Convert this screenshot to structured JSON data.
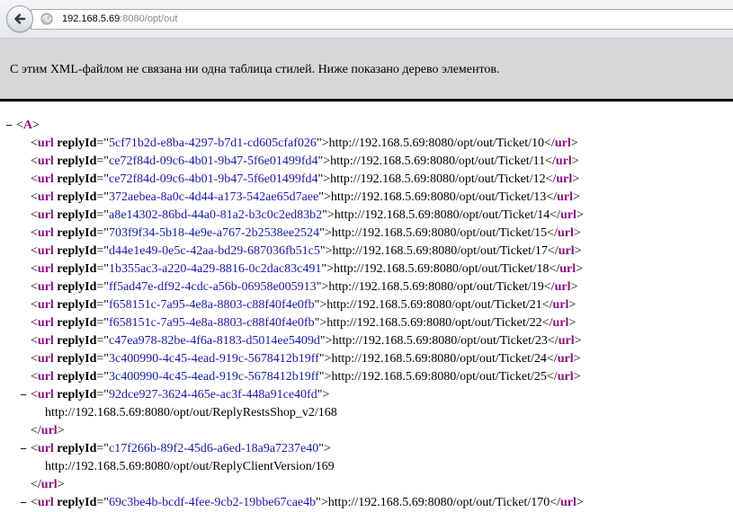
{
  "browser": {
    "url_host": "192.168.5.69",
    "url_rest": ":8080/opt/out"
  },
  "info_message": "С этим XML-файлом не связана ни одна таблица стилей. Ниже показано дерево элементов.",
  "xml": {
    "root_tag": "A",
    "child_tag": "url",
    "attr_name": "replyId",
    "toggle_symbol": "−",
    "single_line_items": [
      {
        "reply_id": "5cf71b2d-e8ba-4297-b7d1-cd605cfaf026",
        "text": "http://192.168.5.69:8080/opt/out/Ticket/10"
      },
      {
        "reply_id": "ce72f84d-09c6-4b01-9b47-5f6e01499fd4",
        "text": "http://192.168.5.69:8080/opt/out/Ticket/11"
      },
      {
        "reply_id": "ce72f84d-09c6-4b01-9b47-5f6e01499fd4",
        "text": "http://192.168.5.69:8080/opt/out/Ticket/12"
      },
      {
        "reply_id": "372aebea-8a0c-4d44-a173-542ae65d7aee",
        "text": "http://192.168.5.69:8080/opt/out/Ticket/13"
      },
      {
        "reply_id": "a8e14302-86bd-44a0-81a2-b3c0c2ed83b2",
        "text": "http://192.168.5.69:8080/opt/out/Ticket/14"
      },
      {
        "reply_id": "703f9f34-5b18-4e9e-a767-2b2538ee2524",
        "text": "http://192.168.5.69:8080/opt/out/Ticket/15"
      },
      {
        "reply_id": "d44e1e49-0e5c-42aa-bd29-687036fb51c5",
        "text": "http://192.168.5.69:8080/opt/out/Ticket/17"
      },
      {
        "reply_id": "1b355ac3-a220-4a29-8816-0c2dac83c491",
        "text": "http://192.168.5.69:8080/opt/out/Ticket/18"
      },
      {
        "reply_id": "ff5ad47e-df92-4cdc-a56b-06958e005913",
        "text": "http://192.168.5.69:8080/opt/out/Ticket/19"
      },
      {
        "reply_id": "f658151c-7a95-4e8a-8803-c88f40f4e0fb",
        "text": "http://192.168.5.69:8080/opt/out/Ticket/21"
      },
      {
        "reply_id": "f658151c-7a95-4e8a-8803-c88f40f4e0fb",
        "text": "http://192.168.5.69:8080/opt/out/Ticket/22"
      },
      {
        "reply_id": "c47ea978-82be-4f6a-8183-d5014ee5409d",
        "text": "http://192.168.5.69:8080/opt/out/Ticket/23"
      },
      {
        "reply_id": "3c400990-4c45-4ead-919c-5678412b19ff",
        "text": "http://192.168.5.69:8080/opt/out/Ticket/24"
      },
      {
        "reply_id": "3c400990-4c45-4ead-919c-5678412b19ff",
        "text": "http://192.168.5.69:8080/opt/out/Ticket/25"
      }
    ],
    "expanded_items": [
      {
        "reply_id": "92dce927-3624-465e-ac3f-448a91ce40fd",
        "text": "http://192.168.5.69:8080/opt/out/ReplyRestsShop_v2/168"
      },
      {
        "reply_id": "c17f266b-89f2-45d6-a6ed-18a9a7237e40",
        "text": "http://192.168.5.69:8080/opt/out/ReplyClientVersion/169"
      }
    ],
    "partial_item": {
      "reply_id": "69c3be4b-bcdf-4fee-9cb2-19bbe67cae4b",
      "text": "http://192.168.5.69:8080/opt/out/Ticket/170"
    }
  }
}
